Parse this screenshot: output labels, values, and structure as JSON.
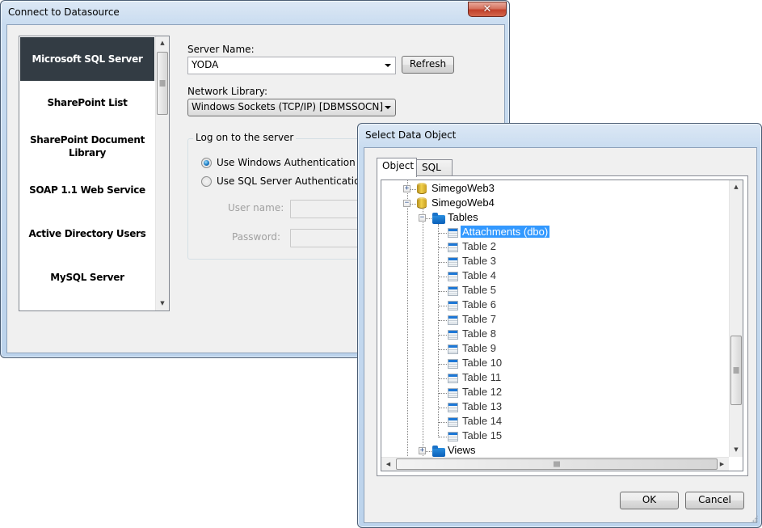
{
  "connect_dialog": {
    "title": "Connect to Datasource",
    "close_glyph": "✕",
    "datasources": [
      {
        "label": "Microsoft SQL Server",
        "selected": true
      },
      {
        "label": "SharePoint List",
        "selected": false
      },
      {
        "label": "SharePoint Document Library",
        "selected": false
      },
      {
        "label": "SOAP 1.1 Web Service",
        "selected": false
      },
      {
        "label": "Active Directory Users",
        "selected": false
      },
      {
        "label": "MySQL Server",
        "selected": false
      }
    ],
    "server_name_label": "Server Name:",
    "server_name_value": "YODA",
    "refresh_label": "Refresh",
    "network_library_label": "Network Library:",
    "network_library_value": "Windows Sockets (TCP/IP) [DBMSSOCN]",
    "logon_group_title": "Log on to the server",
    "auth_options": [
      {
        "label": "Use Windows Authentication",
        "checked": true
      },
      {
        "label": "Use SQL Server Authentication",
        "checked": false
      }
    ],
    "username_label": "User name:",
    "username_value": "",
    "password_label": "Password:",
    "password_value": ""
  },
  "select_dialog": {
    "title": "Select Data Object",
    "tabs": [
      {
        "label": "Object",
        "active": true
      },
      {
        "label": "SQL",
        "active": false
      }
    ],
    "tree": {
      "databases": [
        {
          "label": "SimegoWeb3",
          "expanded": false
        },
        {
          "label": "SimegoWeb4",
          "expanded": true
        }
      ],
      "tables_folder": "Tables",
      "tables": [
        "Attachments (dbo)",
        "Table 2",
        "Table 3",
        "Table 4",
        "Table 5",
        "Table 6",
        "Table 7",
        "Table 8",
        "Table 9",
        "Table 10",
        "Table 11",
        "Table 12",
        "Table 13",
        "Table 14",
        "Table 15"
      ],
      "selected_table": "Attachments (dbo)",
      "views_folder": "Views"
    },
    "ok_label": "OK",
    "cancel_label": "Cancel"
  },
  "icons": {
    "expand": "+",
    "collapse": "−",
    "scroll_up": "▲",
    "scroll_down": "▼",
    "scroll_left": "◀",
    "scroll_right": "▶"
  }
}
